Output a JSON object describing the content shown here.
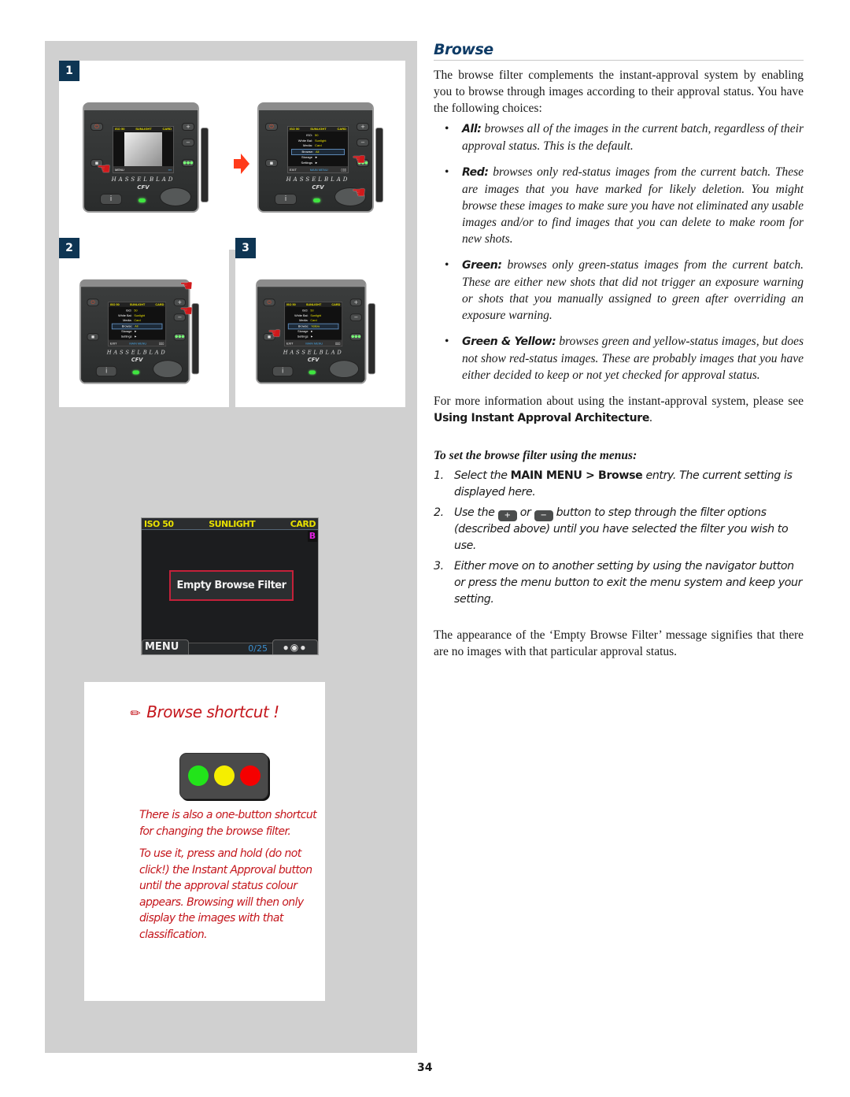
{
  "section": {
    "title": "Browse",
    "intro": "The browse filter complements the instant-approval system by enabling you to browse through images according to their approval status. You have the following choices:",
    "choices": [
      {
        "term": "All:",
        "text": " browses all of the images in the current batch, regardless of their approval status. This is the default."
      },
      {
        "term": "Red:",
        "text": " browses only red-status images from the current batch. These are images that you have marked for likely deletion. You might browse these images to make sure you have not eliminated any usable images and/or to find images that you can delete to make room for new shots."
      },
      {
        "term": "Green:",
        "text": " browses only green-status images from the current batch. These are either new shots that did not trigger an exposure warning or shots that you manually assigned to green after overriding an exposure warning."
      },
      {
        "term": "Green & Yellow:",
        "text": " browses green and yellow-status images, but does not show red-status images. These are probably images that you have either decided to keep or not yet checked for approval status."
      }
    ],
    "more_info_prefix": "For more information about using the instant-approval system, please see ",
    "more_info_link": "Using Instant Approval Architecture",
    "more_info_suffix": ".",
    "procedure_heading": "To set the browse filter using the menus:",
    "steps": [
      {
        "num": "1.",
        "pre": "Select the ",
        "bold": "MAIN MENU > Browse",
        "post": " entry. The current setting is displayed here."
      },
      {
        "num": "2.",
        "pre": "Use the ",
        "plus_icon": "+",
        "mid": " or ",
        "minus_icon": "−",
        "post": " button to step through the filter options (described above) until you have selected the filter you wish to use."
      },
      {
        "num": "3.",
        "pre": "Either move on to another setting by using the navigator button or press the menu button to exit the menu system and keep your setting.",
        "bold": "",
        "post": ""
      }
    ],
    "closing": "The appearance of the ‘Empty Browse Filter’ message signifies that there are no images with that particular approval status."
  },
  "figures": {
    "steps": [
      "1",
      "2",
      "3"
    ],
    "camera": {
      "brand": "HASSELBLAD",
      "model": "CFV",
      "status_bar": {
        "iso": "ISO 50",
        "wb": "SUNLIGHT",
        "media": "CARD"
      },
      "menu_rows": [
        {
          "key": "ISO:",
          "value": "50"
        },
        {
          "key": "White Bal:",
          "value": "Sunlight"
        },
        {
          "key": "Media:",
          "value": "Card"
        },
        {
          "key": "Browse:",
          "value": "All"
        },
        {
          "key": "Storage",
          "value": "►"
        },
        {
          "key": "Settings",
          "value": "►"
        }
      ],
      "menu_rows_step3_browse": "Yellow",
      "bottom_exit": "EXIT",
      "bottom_main_menu": "MAIN MENU",
      "bottom_menu": "MENU",
      "info_button": "i"
    },
    "empty_screen": {
      "iso": "ISO 50",
      "wb": "SUNLIGHT",
      "media": "CARD",
      "badge": "B",
      "message": "Empty Browse Filter",
      "menu": "MENU",
      "count": "0/25",
      "nav_dots": "●◉●"
    }
  },
  "tip": {
    "title": "Browse shortcut !",
    "lights": [
      "#22e41a",
      "#f5ee00",
      "#f50000"
    ],
    "p1": "There is also a one-button shortcut for changing the browse filter.",
    "p2": "To use it, press and hold (do not click!) the Instant Approval button until the approval status colour appears. Browsing will then only display the images with that classification."
  },
  "page_number": "34"
}
